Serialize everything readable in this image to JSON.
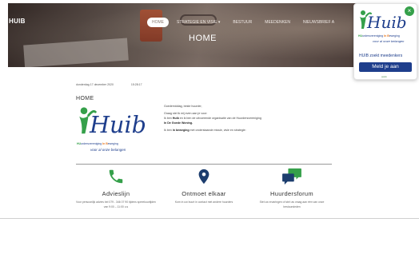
{
  "header": {
    "brand": "HUIB",
    "nav": [
      {
        "label": "HOME",
        "active": true
      },
      {
        "label": "STRATEGIE EN VISIE ▾",
        "active": false
      },
      {
        "label": "BESTUUR",
        "active": false
      },
      {
        "label": "MEEDENKEN",
        "active": false
      },
      {
        "label": "NIEUWSBRIEF A",
        "active": false
      }
    ],
    "title": "HOME"
  },
  "popup": {
    "close": "×",
    "logo_text": "Huib",
    "sub_prefix": "HU",
    "sub_1": "urdersvereniging ",
    "sub_in": "In",
    "sub_b": " B",
    "sub_2": "eweging",
    "tagline": "voor al onze belangen",
    "text": "HUIB zoekt meedenkers",
    "button": "Meld je aan",
    "powered": "poptin"
  },
  "content": {
    "date": "donderdag 17 december 2020",
    "time": "15:28:17",
    "heading": "HOME",
    "logo_text": "Huib",
    "logo_sub_prefix": "HU",
    "logo_sub_1": "urdersvereniging ",
    "logo_sub_in": "In",
    "logo_sub_b": " B",
    "logo_sub_2": "eweging",
    "logo_tagline": "voor al onze belangen",
    "greeting": "Goedemiddag, beste huurder,",
    "intro_1": "Graag stel ik mij even aan je voor:",
    "intro_2a": "Ik ben ",
    "intro_2b": "Huib",
    "intro_2c": " en ik ben de uitvoerende organisatie van de Huurdersvereniging",
    "intro_3": "In De Goede Woning.",
    "intro_4a": "Ik ben ",
    "intro_4b": "in beweging",
    "intro_4c": " met onderstaande missie, visie en strategie:"
  },
  "features": [
    {
      "icon": "phone-icon",
      "title": "Advieslijn",
      "text": "Voor persoonlijk advies bel 079 - 346 07 90 tijdens spreekuurtijden van 9:00 – 11:00 u.s"
    },
    {
      "icon": "location-pin-icon",
      "title": "Ontmoet elkaar",
      "text": "Kom in uw buurt in contact met andere huurders"
    },
    {
      "icon": "chat-bubbles-icon",
      "title": "Huurdersforum",
      "text": "Stel uw ervaringen of stel uw vraag aan één van onze bestuursleden"
    }
  ],
  "colors": {
    "green": "#35a04a",
    "navy": "#1e3e8c",
    "orange": "#e8791f",
    "blue": "#2a6db5",
    "dark_blue": "#1c3d6e"
  }
}
